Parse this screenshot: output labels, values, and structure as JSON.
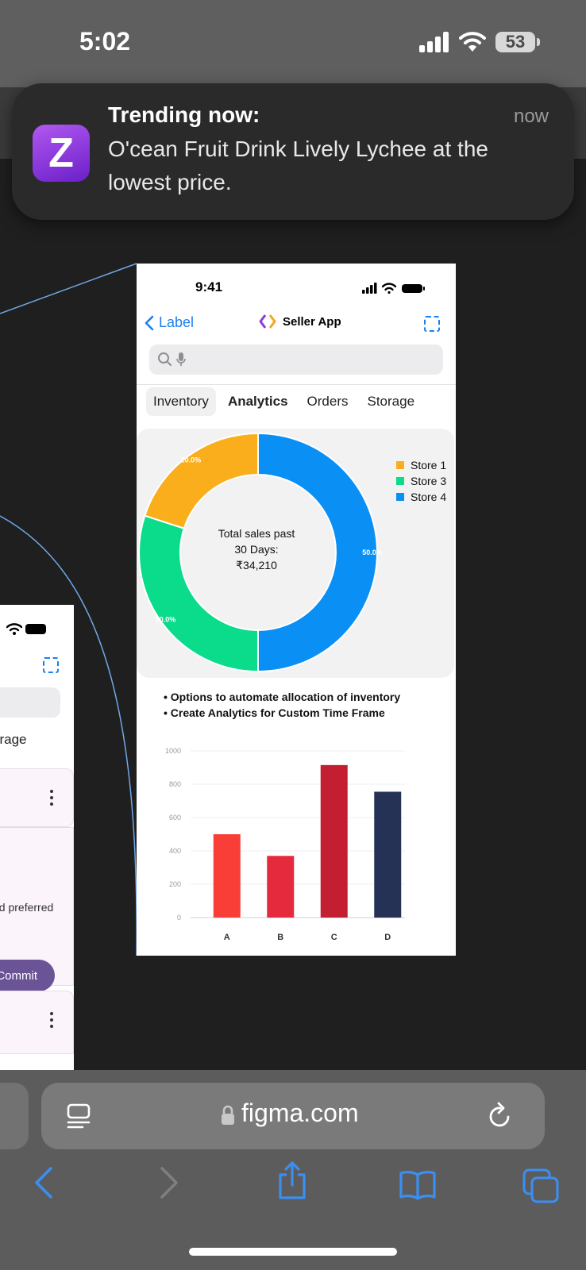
{
  "status_bar": {
    "time": "5:02",
    "battery": "53"
  },
  "notification": {
    "app_letter": "Z",
    "title": "Trending now:",
    "body": "O'cean Fruit Drink Lively Lychee at the lowest price.",
    "when": "now"
  },
  "mockup": {
    "time": "9:41",
    "back_label": "Label",
    "title": "Seller App",
    "tabs": [
      {
        "label": "Inventory"
      },
      {
        "label": "Analytics"
      },
      {
        "label": "Orders"
      },
      {
        "label": "Storage"
      }
    ],
    "center_text": [
      "Total sales past",
      "30 Days:",
      "₹34,210"
    ],
    "bullets": [
      "Options to automate allocation of inventory",
      "Create Analytics for Custom Time Frame"
    ]
  },
  "chart_data": [
    {
      "type": "pie",
      "subtype": "donut",
      "categories": [
        "Store 4",
        "Store 3",
        "Store 1"
      ],
      "values": [
        50.0,
        30.0,
        20.0
      ],
      "value_labels": [
        "50.0%",
        "30.0%",
        "20.0%"
      ],
      "colors": [
        "#0a8ff5",
        "#0adc8c",
        "#fbae1c"
      ],
      "legend": [
        {
          "label": "Store 1",
          "color": "#fbae1c"
        },
        {
          "label": "Store 3",
          "color": "#0adc8c"
        },
        {
          "label": "Store 4",
          "color": "#0a8ff5"
        }
      ],
      "legend_position": "top-right"
    },
    {
      "type": "bar",
      "categories": [
        "A",
        "B",
        "C",
        "D"
      ],
      "values": [
        500,
        370,
        915,
        755
      ],
      "colors": [
        "#f93d37",
        "#e42a3c",
        "#c41e33",
        "#253255"
      ],
      "ylim": [
        0,
        1000
      ],
      "yticks": [
        "0",
        "200",
        "400",
        "600",
        "800",
        "1000"
      ]
    }
  ],
  "partial_mockup": {
    "tab_fragment": "orage",
    "text_fragment": "nd preferred",
    "commit_label": "Commit"
  },
  "browser": {
    "url": "figma.com"
  }
}
